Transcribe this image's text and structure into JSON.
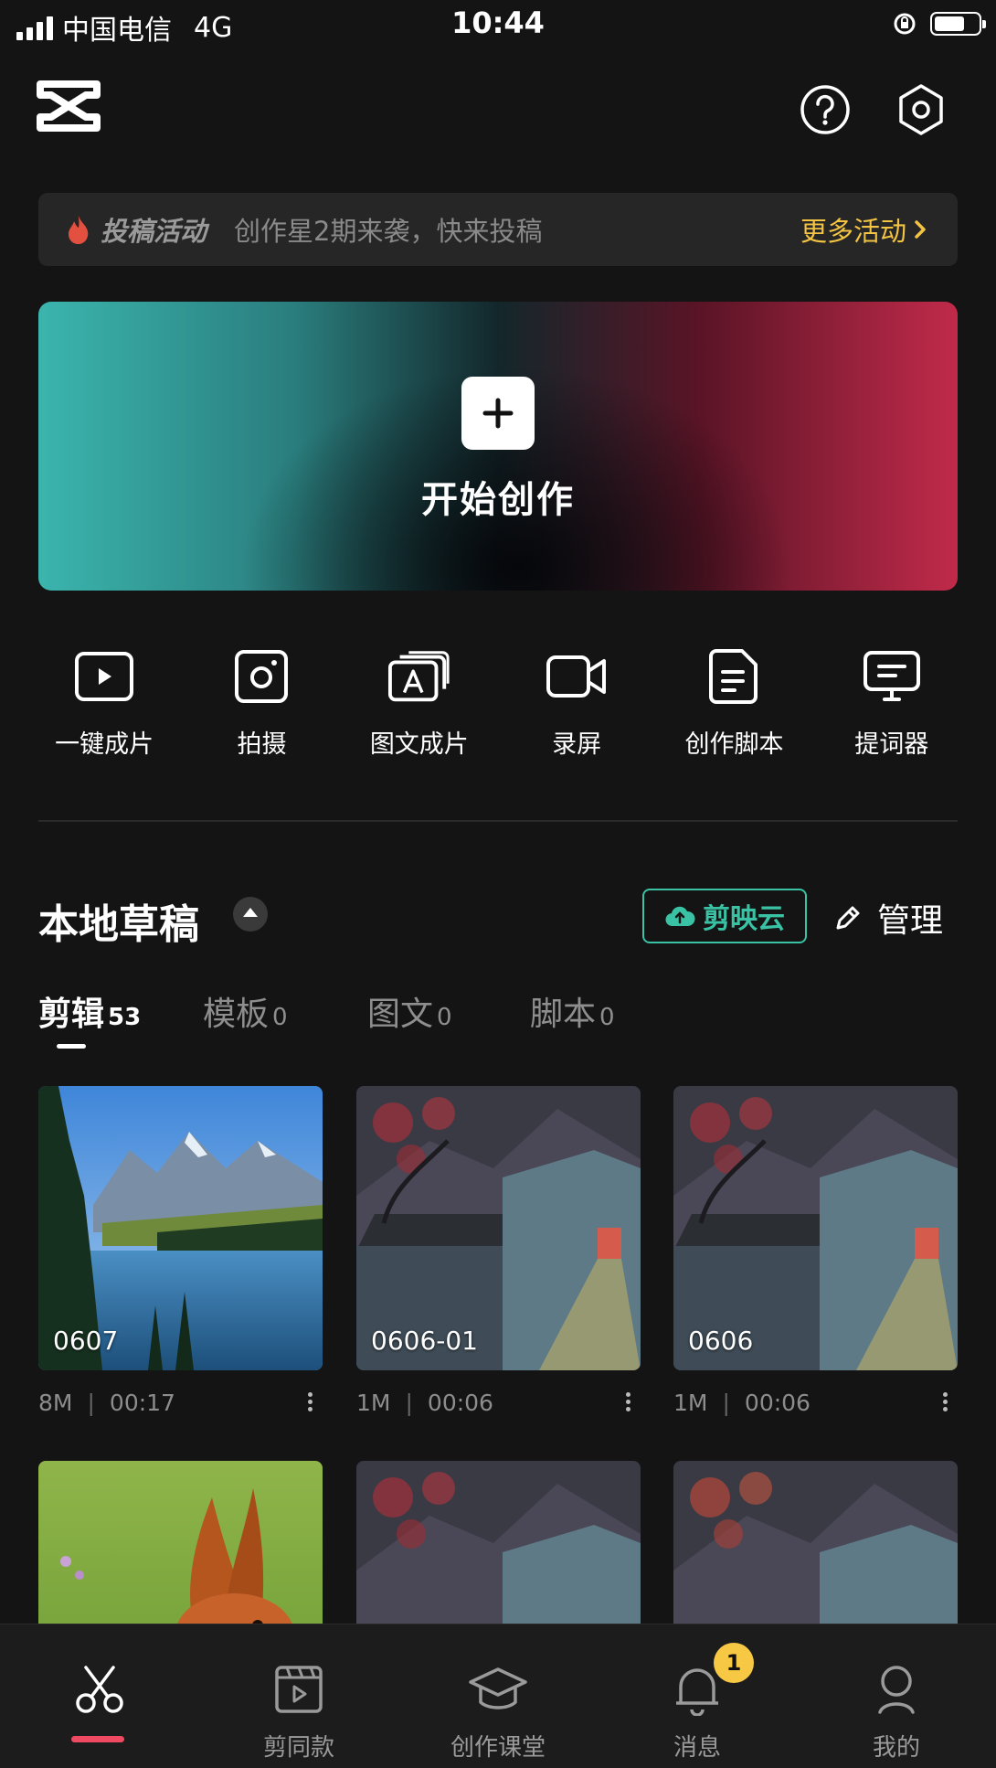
{
  "status_bar": {
    "carrier": "中国电信",
    "network": "4G",
    "time": "10:44",
    "battery_level": 0.7
  },
  "header": {
    "logo_icon": "capcut-logo-icon",
    "help_icon": "help-circle-icon",
    "settings_icon": "hexagon-settings-icon"
  },
  "activity_banner": {
    "tag": "投稿活动",
    "text": "创作星2期来袭，快来投稿",
    "more_label": "更多活动",
    "accent_color": "#f3c343"
  },
  "create_banner": {
    "label": "开始创作",
    "icon": "plus-icon"
  },
  "tools": [
    {
      "label": "一键成片",
      "icon": "play-square-icon"
    },
    {
      "label": "拍摄",
      "icon": "camera-icon"
    },
    {
      "label": "图文成片",
      "icon": "text-to-video-icon"
    },
    {
      "label": "录屏",
      "icon": "video-camera-icon"
    },
    {
      "label": "创作脚本",
      "icon": "script-doc-icon"
    },
    {
      "label": "提词器",
      "icon": "teleprompter-icon"
    }
  ],
  "drafts": {
    "title": "本地草稿",
    "cloud_label": "剪映云",
    "manage_label": "管理",
    "tabs": [
      {
        "label": "剪辑",
        "count": "53",
        "active": true
      },
      {
        "label": "模板",
        "count": "0",
        "active": false
      },
      {
        "label": "图文",
        "count": "0",
        "active": false
      },
      {
        "label": "脚本",
        "count": "0",
        "active": false
      }
    ],
    "items": [
      {
        "title": "0607",
        "size": "8M",
        "duration": "00:17",
        "image": "mountain-lake"
      },
      {
        "title": "0606-01",
        "size": "1M",
        "duration": "00:06",
        "image": "night-village"
      },
      {
        "title": "0606",
        "size": "1M",
        "duration": "00:06",
        "image": "night-village"
      },
      {
        "title": "",
        "image": "squirrel"
      },
      {
        "title": "",
        "image": "night-village"
      },
      {
        "title": "",
        "image": "night-village"
      }
    ]
  },
  "bottom_nav": [
    {
      "label": "",
      "icon": "scissors-icon",
      "active": true
    },
    {
      "label": "剪同款",
      "icon": "film-template-icon"
    },
    {
      "label": "创作课堂",
      "icon": "graduation-cap-icon"
    },
    {
      "label": "消息",
      "icon": "bell-icon",
      "badge": "1"
    },
    {
      "label": "我的",
      "icon": "user-icon"
    }
  ],
  "colors": {
    "background": "#141414",
    "accent_cloud": "#39c2a3",
    "active_nav": "#f04a63",
    "badge": "#f7c843"
  }
}
